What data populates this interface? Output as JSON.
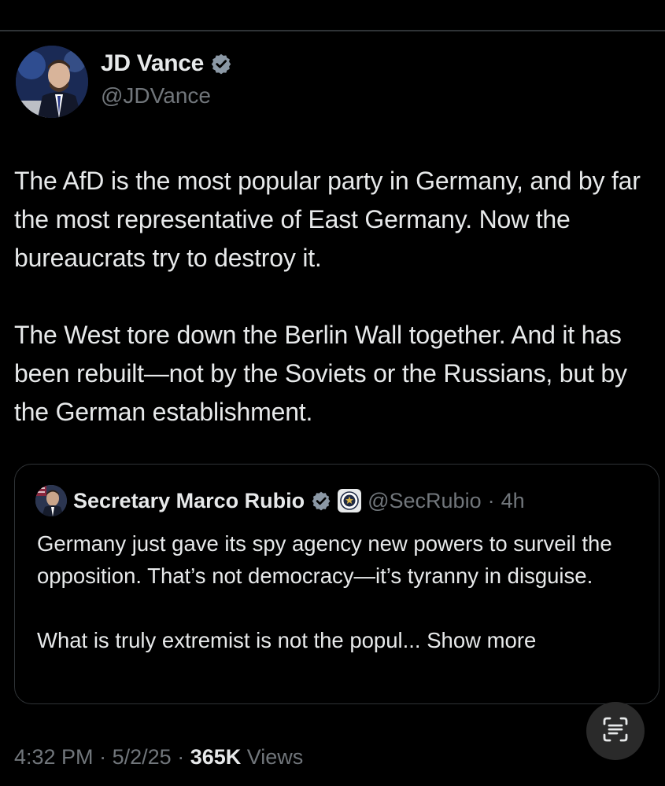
{
  "tweet": {
    "author": {
      "name": "JD Vance",
      "handle": "@JDVance"
    },
    "paragraphs": [
      "The AfD is the most popular party in Germany, and by far the most representative of East Germany. Now the bureaucrats try to destroy it.",
      "The West tore down the Berlin Wall together. And it has been rebuilt—not by the Soviets or the Russians, but by the German establishment."
    ],
    "time": "4:32 PM",
    "date": "5/2/25",
    "views_count": "365K",
    "views_label": "Views",
    "separator": "·"
  },
  "quoted_tweet": {
    "author": {
      "name": "Secretary Marco Rubio",
      "handle": "@SecRubio"
    },
    "separator": "·",
    "time_ago": "4h",
    "paragraphs": [
      "Germany just gave its spy agency new powers to surveil the opposition.  That’s not democracy—it’s tyranny in disguise.",
      "What is truly extremist is not the popul..."
    ],
    "show_more_label": "Show more"
  },
  "icons": {
    "verified": "verified-badge-icon",
    "government": "government-seal-icon",
    "floating_action": "text-scan-icon"
  },
  "colors": {
    "background": "#000000",
    "primary_text": "#e7e9ea",
    "secondary_text": "#71767b",
    "border": "#2f3336",
    "verified_badge": "#1d9bf0"
  }
}
